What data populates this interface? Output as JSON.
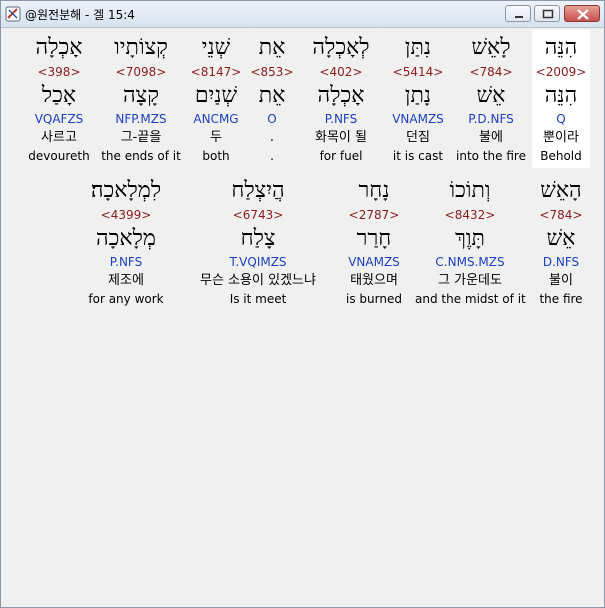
{
  "window": {
    "title": "@원전분해 - 겔 15:4"
  },
  "row1": [
    {
      "heb": "הִנֵּה",
      "num": "<2009>",
      "lex": "הִנֵּה",
      "morph": "Q",
      "kor": "뿐이라",
      "eng": "Behold"
    },
    {
      "heb": "לָאֵשׁ",
      "num": "<784>",
      "lex": "אֵשׁ",
      "morph": "P.D.NFS",
      "kor": "불에",
      "eng": "into the fire"
    },
    {
      "heb": "נִתַּן",
      "num": "<5414>",
      "lex": "נָתַן",
      "morph": "VNAMZS",
      "kor": "던짐",
      "eng": "it is cast"
    },
    {
      "heb": "לְאָכְלָה",
      "num": "<402>",
      "lex": "אָכְלָה",
      "morph": "P.NFS",
      "kor": "화목이 될",
      "eng": "for fuel"
    },
    {
      "heb": "אֵת",
      "num": "<853>",
      "lex": "אֵת",
      "morph": "O",
      "kor": ".",
      "eng": "."
    },
    {
      "heb": "שְׁנֵי",
      "num": "<8147>",
      "lex": "שְׁנַיִם",
      "morph": "ANCMG",
      "kor": "두",
      "eng": "both"
    },
    {
      "heb": "קְצוֹתָיו",
      "num": "<7098>",
      "lex": "קָצָה",
      "morph": "NFP.MZS",
      "kor": "그-끝을",
      "eng": "the ends of it"
    },
    {
      "heb": "אָכְלָה",
      "num": "<398>",
      "lex": "אָכַל",
      "morph": "VQAFZS",
      "kor": "사르고",
      "eng": "devoureth"
    }
  ],
  "row2": [
    {
      "heb": "הָאֵשׁ",
      "num": "<784>",
      "lex": "אֵשׁ",
      "morph": "D.NFS",
      "kor": "불이",
      "eng": "the fire"
    },
    {
      "heb": "וְתוֹכוֹ",
      "num": "<8432>",
      "lex": "תָּוֶךְ",
      "morph": "C.NMS.MZS",
      "kor": "그 가운데도",
      "eng": "and the midst of it"
    },
    {
      "heb": "נָחָר",
      "num": "<2787>",
      "lex": "חָרַר",
      "morph": "VNAMZS",
      "kor": "태웠으며",
      "eng": "is burned"
    },
    {
      "heb": "הֲיִצְלַח",
      "num": "<6743>",
      "lex": "צָלַח",
      "morph": "T.VQIMZS",
      "kor": "무슨 소용이 있겠느냐",
      "eng": "Is it meet"
    },
    {
      "heb": "לִמְלָאכָה׃",
      "num": "<4399>",
      "lex": "מְלָאכָה",
      "morph": "P.NFS",
      "kor": "제조에",
      "eng": "for any work"
    }
  ]
}
